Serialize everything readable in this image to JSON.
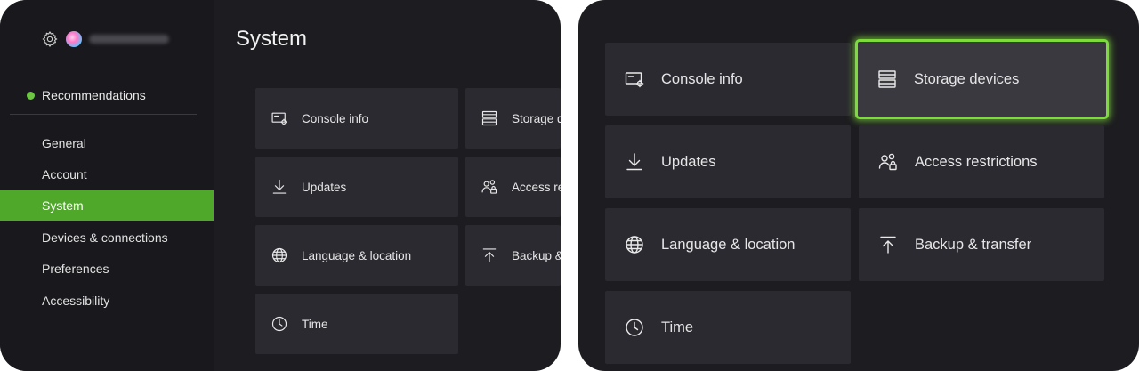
{
  "left": {
    "profile": {
      "gamertag": ""
    },
    "recommendations_label": "Recommendations",
    "nav": [
      {
        "label": "General"
      },
      {
        "label": "Account"
      },
      {
        "label": "System",
        "active": true
      },
      {
        "label": "Devices & connections"
      },
      {
        "label": "Preferences"
      },
      {
        "label": "Accessibility"
      }
    ],
    "page_title": "System",
    "tiles": {
      "console_info": "Console info",
      "storage_devices": "Storage d",
      "updates": "Updates",
      "access_restrictions": "Access re",
      "language_location": "Language & location",
      "backup_transfer": "Backup &",
      "time": "Time"
    }
  },
  "right": {
    "tiles": {
      "console_info": "Console info",
      "storage_devices": "Storage devices",
      "updates": "Updates",
      "access_restrictions": "Access restrictions",
      "language_location": "Language & location",
      "backup_transfer": "Backup & transfer",
      "time": "Time"
    },
    "focused_tile": "storage_devices"
  },
  "colors": {
    "accent_green": "#4fa82a",
    "focus_green": "#7ddc3c",
    "panel_bg": "#1d1c20",
    "tile_bg": "#2b2a30"
  },
  "icons": [
    "gear-icon",
    "console-info-icon",
    "storage-icon",
    "download-icon",
    "people-lock-icon",
    "globe-icon",
    "upload-icon",
    "clock-icon"
  ]
}
